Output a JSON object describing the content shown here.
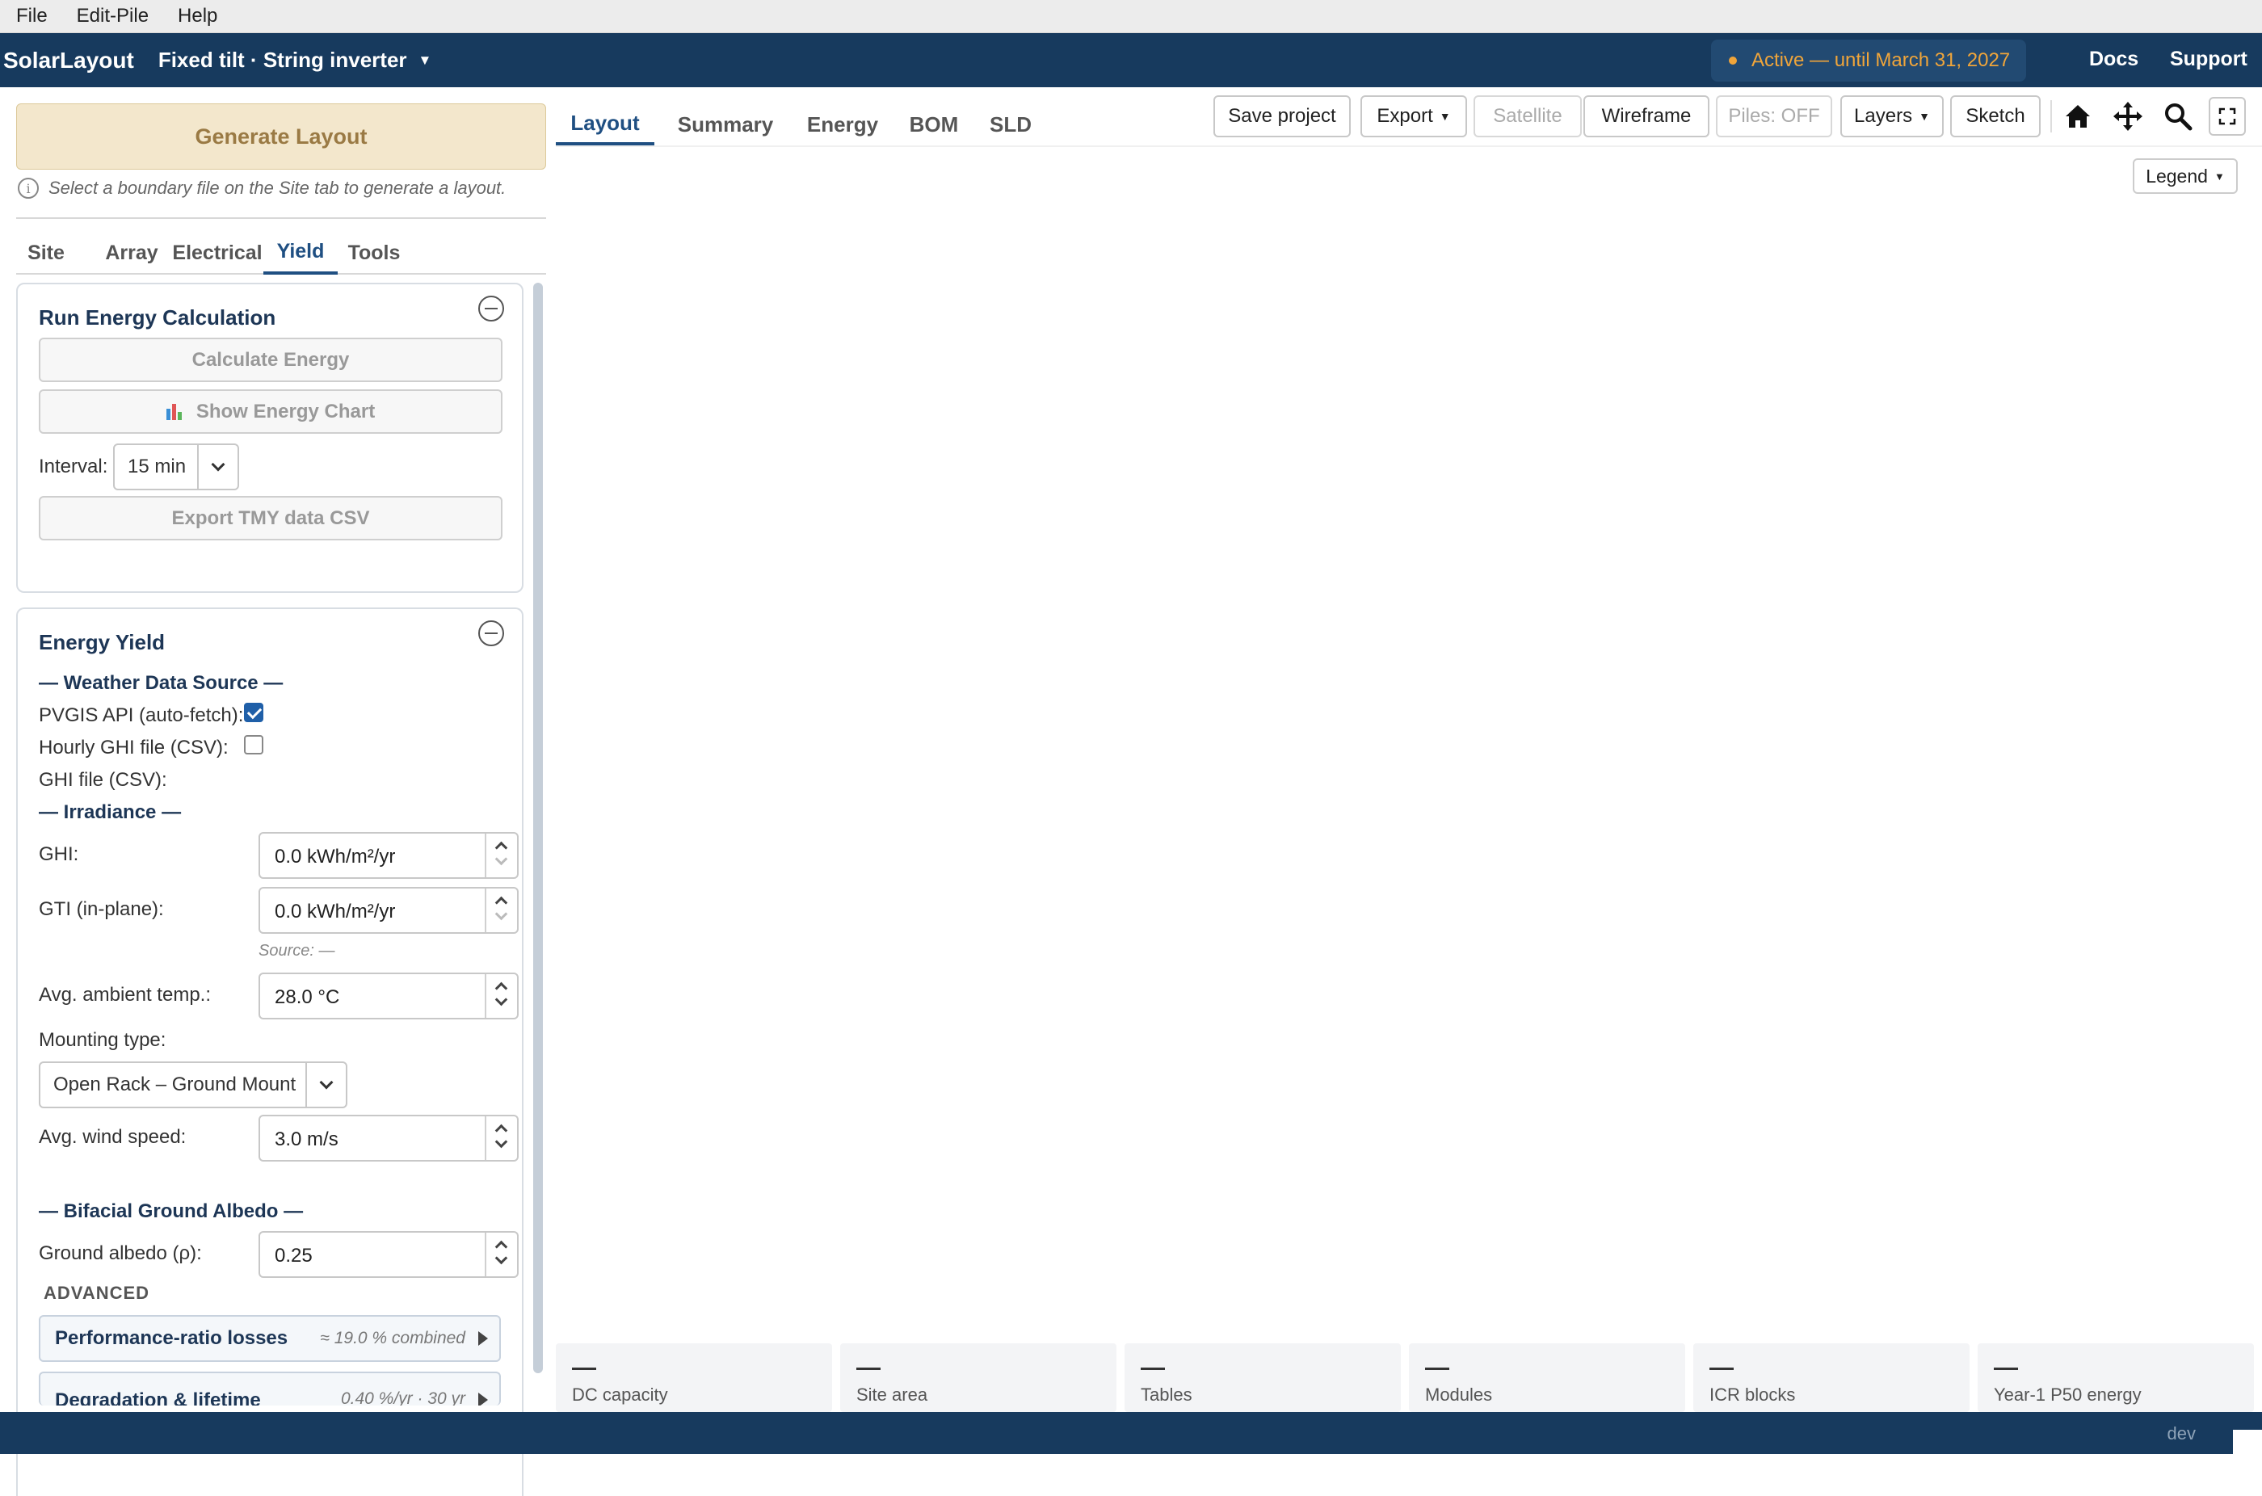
{
  "menu": [
    "File",
    "Edit-Pile",
    "Help"
  ],
  "header": {
    "brand": "SolarLayout",
    "mode": "Fixed tilt · String inverter",
    "license": "Active — until March 31, 2027",
    "docs": "Docs",
    "support": "Support"
  },
  "left": {
    "generate": "Generate Layout",
    "hint": "Select a boundary file on the Site tab to generate a layout.",
    "tabs": [
      "Site",
      "Array",
      "Electrical",
      "Yield",
      "Tools"
    ],
    "active_tab": "Yield",
    "run": {
      "title": "Run Energy Calculation",
      "calculate": "Calculate Energy",
      "show_chart": "Show Energy Chart",
      "interval_label": "Interval:",
      "interval_value": "15 min",
      "export_tmy": "Export TMY data CSV"
    },
    "yield": {
      "title": "Energy Yield",
      "weather_heading": "— Weather Data Source —",
      "pvgis_label": "PVGIS API (auto-fetch):",
      "pvgis_checked": true,
      "hourly_label": "Hourly GHI file (CSV):",
      "hourly_checked": false,
      "ghi_file_label": "GHI file (CSV):",
      "irradiance_heading": "— Irradiance —",
      "ghi_label": "GHI:",
      "ghi_value": "0.0  kWh/m²/yr",
      "gti_label": "GTI (in-plane):",
      "gti_value": "0.0  kWh/m²/yr",
      "source_note": "Source: —",
      "temp_label": "Avg. ambient temp.:",
      "temp_value": "28.0  °C",
      "mounting_label": "Mounting type:",
      "mounting_value": "Open Rack – Ground Mount",
      "wind_label": "Avg. wind speed:",
      "wind_value": "3.0  m/s",
      "albedo_heading": "— Bifacial Ground Albedo —",
      "albedo_label": "Ground albedo (ρ):",
      "albedo_value": "0.25",
      "advanced": "ADVANCED",
      "pr_losses": "Performance-ratio losses",
      "pr_losses_sub": "≈ 19.0 % combined",
      "degradation": "Degradation & lifetime",
      "degradation_sub": "0.40 %/yr · 30 yr"
    }
  },
  "main": {
    "tabs": [
      "Layout",
      "Summary",
      "Energy",
      "BOM",
      "SLD"
    ],
    "active_tab": "Layout",
    "toolbar": {
      "save": "Save project",
      "export": "Export",
      "satellite": "Satellite",
      "wireframe": "Wireframe",
      "piles": "Piles: OFF",
      "layers": "Layers",
      "sketch": "Sketch"
    },
    "legend": "Legend",
    "stats": [
      {
        "value": "—",
        "label": "DC capacity"
      },
      {
        "value": "—",
        "label": "Site area"
      },
      {
        "value": "—",
        "label": "Tables"
      },
      {
        "value": "—",
        "label": "Modules"
      },
      {
        "value": "—",
        "label": "ICR blocks"
      },
      {
        "value": "—",
        "label": "Year-1 P50 energy"
      }
    ]
  },
  "footer": {
    "env": "dev"
  },
  "colors": {
    "navy": "#173a5e",
    "accent": "#1f4f82",
    "license": "#f0a53a",
    "generate_bg": "#f3e7cc"
  },
  "icons": [
    "info-icon",
    "collapse-icon",
    "bar-chart-icon",
    "chevron-down-icon",
    "home-icon",
    "move-icon",
    "search-icon",
    "fullscreen-icon"
  ]
}
